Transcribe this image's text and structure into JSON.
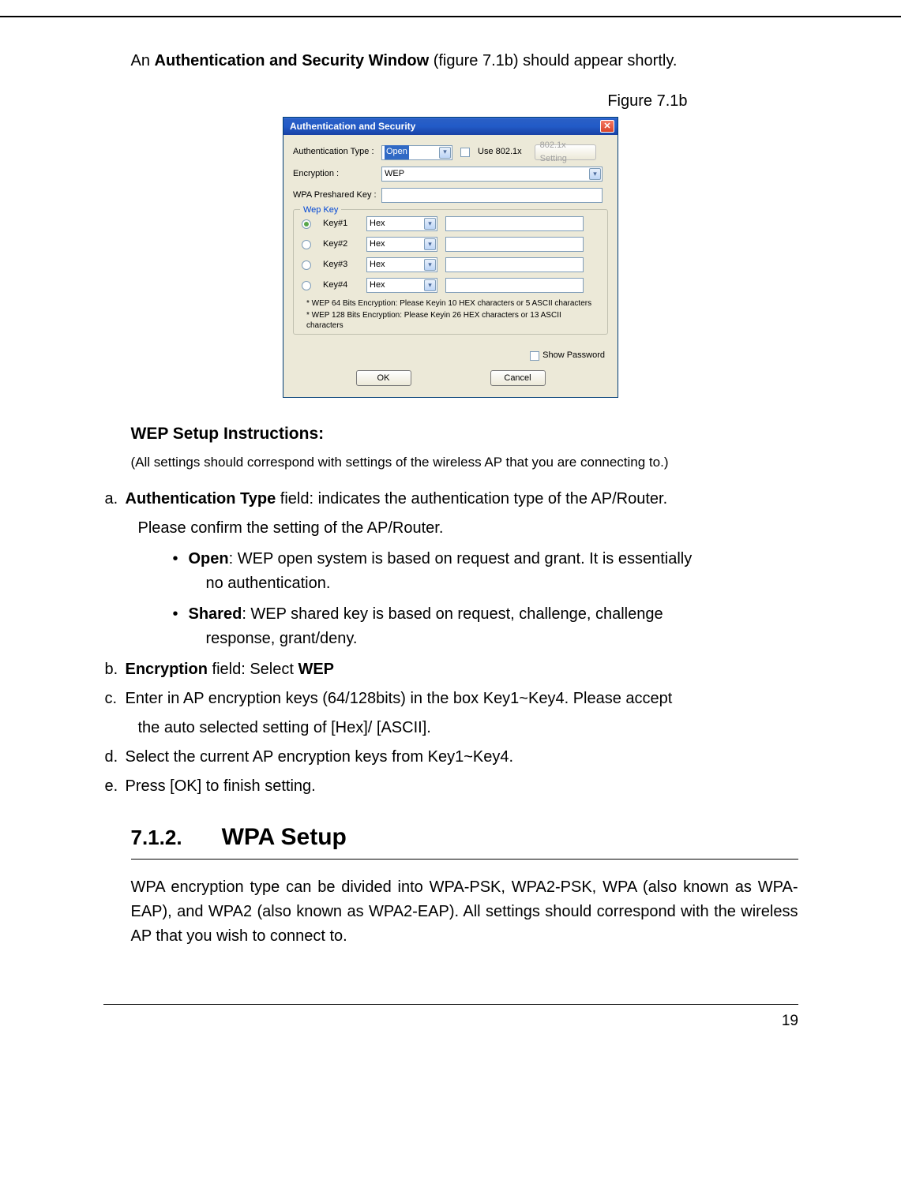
{
  "intro": {
    "prefix": "An ",
    "bold": "Authentication and Security Window",
    "suffix": " (figure 7.1b) should appear shortly."
  },
  "figure_caption": "Figure 7.1b",
  "dialog": {
    "title": "Authentication and Security",
    "labels": {
      "auth_type": "Authentication Type :",
      "encryption": "Encryption :",
      "wpa_psk": "WPA Preshared Key :"
    },
    "auth_type_value": "Open",
    "use_8021x_label": "Use 802.1x",
    "button_8021x": "802.1x Setting",
    "encryption_value": "WEP",
    "wep_legend": "Wep Key",
    "keys": [
      {
        "label": "Key#1",
        "fmt": "Hex",
        "selected": true
      },
      {
        "label": "Key#2",
        "fmt": "Hex",
        "selected": false
      },
      {
        "label": "Key#3",
        "fmt": "Hex",
        "selected": false
      },
      {
        "label": "Key#4",
        "fmt": "Hex",
        "selected": false
      }
    ],
    "hint1": "* WEP 64 Bits Encryption:  Please Keyin 10 HEX characters or 5 ASCII characters",
    "hint2": "* WEP 128 Bits Encryption:  Please Keyin 26 HEX characters or 13 ASCII characters",
    "show_password": "Show Password",
    "ok": "OK",
    "cancel": "Cancel"
  },
  "wep": {
    "heading": "WEP Setup Instructions:",
    "note": "(All settings should correspond with settings of the wireless AP that you are connecting to.)",
    "a_bold": "Authentication Type",
    "a_rest": " field: indicates the authentication type of the AP/Router.",
    "a_line2": "Please confirm the setting of the AP/Router.",
    "open_bold": "Open",
    "open_rest": ": WEP open system is based on request and grant. It is essentially",
    "open_line2": "no authentication.",
    "shared_bold": "Shared",
    "shared_rest": ": WEP shared key is based on request, challenge, challenge",
    "shared_line2": "response, grant/deny.",
    "b_bold1": "Encryption",
    "b_mid": " field:  Select ",
    "b_bold2": "WEP",
    "c": "Enter in AP encryption keys (64/128bits) in the box Key1~Key4.  Please accept",
    "c_line2": "the auto selected setting of [Hex]/ [ASCII].",
    "d": "Select the current AP encryption keys from Key1~Key4.",
    "e": "Press [OK] to finish setting."
  },
  "section": {
    "num": "7.1.2.",
    "title": "WPA Setup"
  },
  "wpa_para": "WPA encryption type can be divided into WPA-PSK, WPA2-PSK, WPA (also known as WPA-EAP), and WPA2 (also known as WPA2-EAP). All settings should correspond with the wireless AP that you wish to connect to.",
  "page_number": "19"
}
